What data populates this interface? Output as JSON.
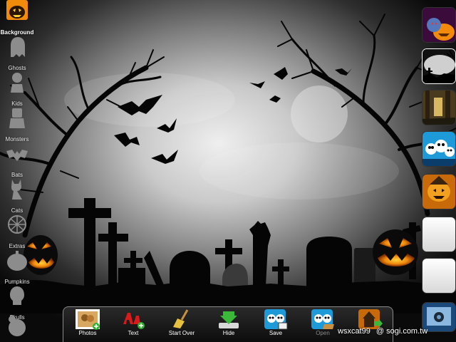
{
  "sidebar": {
    "items": [
      {
        "label": "Background",
        "icon": "background-icon",
        "active": true
      },
      {
        "label": "Ghosts",
        "icon": "ghost-icon"
      },
      {
        "label": "Kids",
        "icon": "kids-icon"
      },
      {
        "label": "Monsters",
        "icon": "monster-icon"
      },
      {
        "label": "Bats",
        "icon": "bat-icon"
      },
      {
        "label": "Cats",
        "icon": "cat-icon"
      },
      {
        "label": "Extras",
        "icon": "extras-icon"
      },
      {
        "label": "Pumpkins",
        "icon": "pumpkin-icon"
      },
      {
        "label": "Skulls",
        "icon": "skull-icon"
      },
      {
        "label": "",
        "icon": "turkey-icon"
      }
    ]
  },
  "thumbnails": [
    {
      "name": "pumpkin-monster-background"
    },
    {
      "name": "foggy-graveyard-background",
      "selected": true
    },
    {
      "name": "haunted-forest-background"
    },
    {
      "name": "skull-kids-background"
    },
    {
      "name": "scarecrow-pumpkin-background"
    },
    {
      "name": "blank-white-background"
    },
    {
      "name": "blank-white-background-2"
    },
    {
      "name": "photo-library-thumbnail"
    }
  ],
  "toolbar": {
    "photos_label": "Photos",
    "text_label": "Text",
    "start_over_label": "Start Over",
    "hide_label": "Hide",
    "save_label": "Save",
    "open_label": "Open",
    "open_disabled": true
  },
  "watermark": {
    "user": "wsxcat99",
    "site": "@ sogi.com.tw"
  },
  "colors": {
    "pumpkin_orange": "#f28a0c",
    "toolbar_border": "#8a8a8a",
    "fog_light": "#d9d9d9"
  }
}
